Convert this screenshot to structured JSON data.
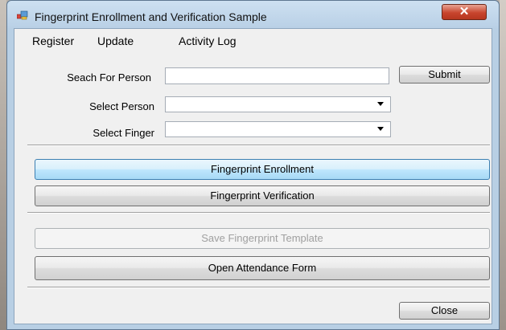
{
  "window": {
    "title": "Fingerprint Enrollment and Verification Sample",
    "close_glyph": "✕"
  },
  "menu": {
    "items": [
      "Register",
      "Update",
      "Activity Log"
    ]
  },
  "form": {
    "search_label": "Seach For Person",
    "search_value": "",
    "submit_label": "Submit",
    "select_person_label": "Select Person",
    "select_person_value": "",
    "select_finger_label": "Select Finger",
    "select_finger_value": ""
  },
  "actions": {
    "enroll_label": "Fingerprint Enrollment",
    "verify_label": "Fingerprint Verification",
    "save_template_label": "Save Fingerprint Template",
    "attendance_label": "Open Attendance Form",
    "close_label": "Close"
  },
  "colors": {
    "title_bar": "#b9d0e6",
    "close_button": "#c8452e",
    "focus_border": "#3c7fb1"
  }
}
